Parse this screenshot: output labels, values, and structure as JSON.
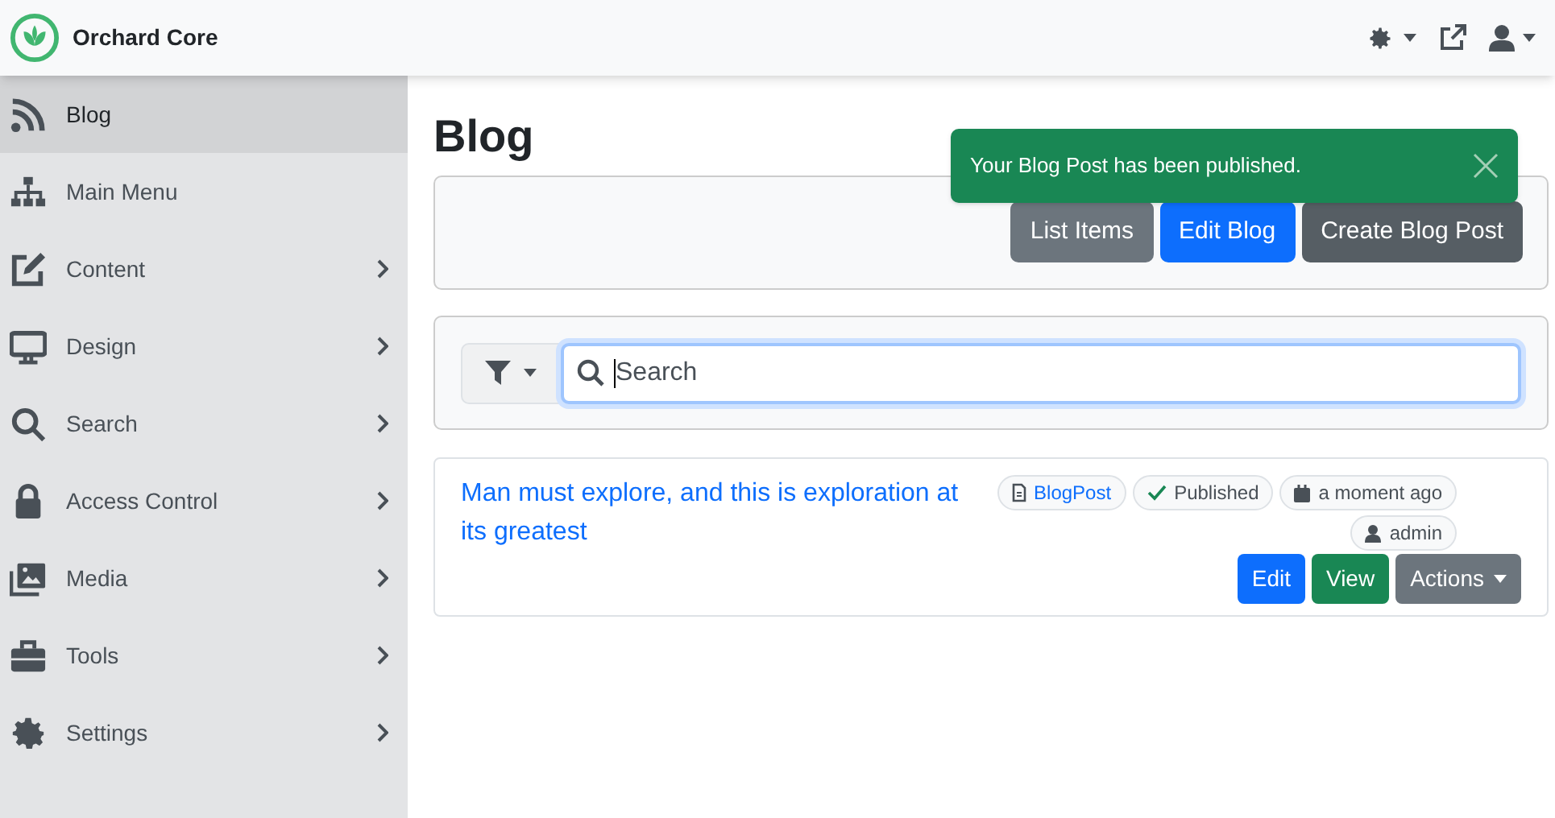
{
  "brand": {
    "name": "Orchard Core"
  },
  "sidebar": {
    "items": [
      {
        "label": "Blog",
        "selected": true,
        "expandable": false
      },
      {
        "label": "Main Menu",
        "selected": false,
        "expandable": false
      },
      {
        "label": "Content",
        "selected": false,
        "expandable": true
      },
      {
        "label": "Design",
        "selected": false,
        "expandable": true
      },
      {
        "label": "Search",
        "selected": false,
        "expandable": true
      },
      {
        "label": "Access Control",
        "selected": false,
        "expandable": true
      },
      {
        "label": "Media",
        "selected": false,
        "expandable": true
      },
      {
        "label": "Tools",
        "selected": false,
        "expandable": true
      },
      {
        "label": "Settings",
        "selected": false,
        "expandable": true
      }
    ]
  },
  "page": {
    "title": "Blog"
  },
  "toast": {
    "message": "Your Blog Post has been published."
  },
  "buttons": [
    {
      "label": "List Items",
      "kind": "secondary"
    },
    {
      "label": "Edit Blog",
      "kind": "primary"
    },
    {
      "label": "Create Blog Post",
      "kind": "dark"
    }
  ],
  "search": {
    "value": "Search"
  },
  "items": [
    {
      "title": "Man must explore, and this is exploration at its greatest",
      "badges": [
        {
          "label": "BlogPost",
          "kind": "type"
        },
        {
          "label": "Published",
          "kind": "status"
        },
        {
          "label": "a moment ago",
          "kind": "date"
        },
        {
          "label": "admin",
          "kind": "author"
        }
      ],
      "actions": [
        {
          "label": "Edit",
          "kind": "primary"
        },
        {
          "label": "View",
          "kind": "success"
        },
        {
          "label": "Actions",
          "kind": "dropdown"
        }
      ]
    }
  ]
}
